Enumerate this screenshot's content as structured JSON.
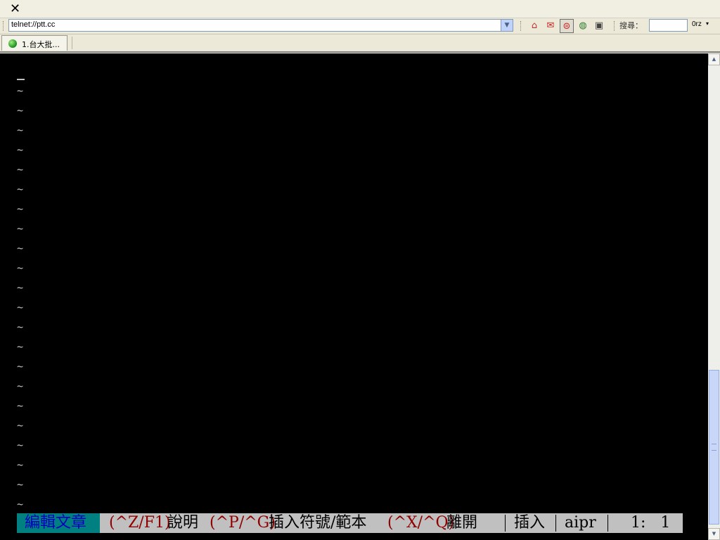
{
  "window": {
    "close_glyph": "✕"
  },
  "toolbar": {
    "address": "telnet://ptt.cc",
    "buttons": [
      {
        "name": "home-button",
        "icon": "home-icon",
        "glyph": "⌂"
      },
      {
        "name": "favorites-button",
        "icon": "favorites-icon",
        "glyph": "✉"
      },
      {
        "name": "connect-button",
        "icon": "connect-icon",
        "glyph": "⊜"
      },
      {
        "name": "web-button",
        "icon": "globe-icon",
        "glyph": "◍"
      },
      {
        "name": "terminal-button",
        "icon": "terminal-icon",
        "glyph": "▣"
      }
    ],
    "search_label": "搜尋：",
    "search_value": "",
    "search_engine": "0rz",
    "search_engine_arrow": "▾"
  },
  "tabs": [
    {
      "label": "1.台大批..."
    }
  ],
  "terminal": {
    "filler_char": "~",
    "filler_rows": 22,
    "status": {
      "mode_title": "編輯文章",
      "help_key": "(^Z/F1)",
      "help_label": "說明",
      "insert_key": "(^P/^G)",
      "insert_label": "插入符號/範本",
      "exit_key": "(^X/^Q)",
      "exit_label": "離開",
      "input_mode": "插入",
      "flags": "aipr",
      "position": "1:   1"
    }
  },
  "colors": {
    "terminal_bg": "#000000",
    "status_bg": "#c0c0c0",
    "title_bg": "#008080",
    "title_fg": "#0000c0",
    "key_fg": "#900000"
  }
}
